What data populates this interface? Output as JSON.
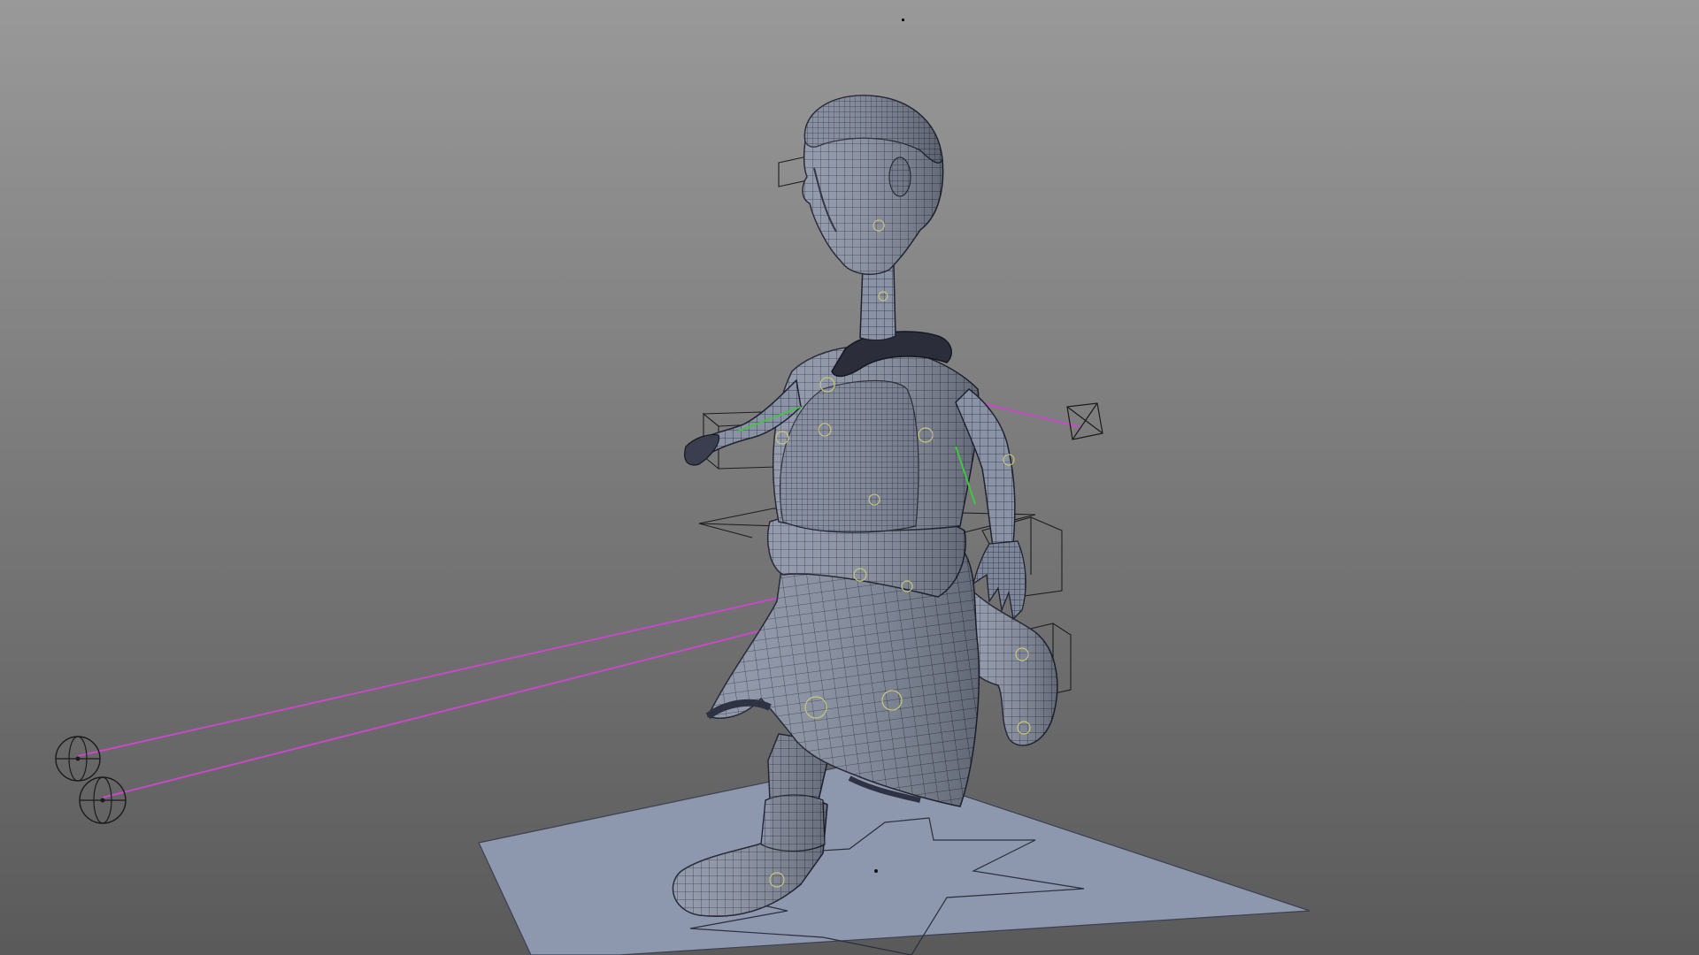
{
  "viewport": {
    "background_top": "#999999",
    "background_bottom": "#5a5a5a",
    "view": "perspective"
  },
  "colors": {
    "ground_plane": "#8d97ad",
    "mesh_fill": "#8a92a5",
    "mesh_shadow": "#5f6677",
    "wireframe": "#1f2230",
    "pole_vector_line": "#c54ac5",
    "ik_handle_line": "#43c443",
    "joint_marker": "#c9c57a",
    "locator": "#111111"
  },
  "scene": {
    "objects": [
      {
        "name": "character-mesh",
        "type": "polygon-mesh",
        "display": "wireframe-on-shaded"
      },
      {
        "name": "ground-plane",
        "type": "nurbs-plane"
      },
      {
        "name": "star-control",
        "type": "nurbs-curve"
      },
      {
        "name": "pole-vector-left-knee",
        "type": "locator"
      },
      {
        "name": "pole-vector-right-knee",
        "type": "locator"
      },
      {
        "name": "pole-vector-arm",
        "type": "locator"
      }
    ]
  }
}
